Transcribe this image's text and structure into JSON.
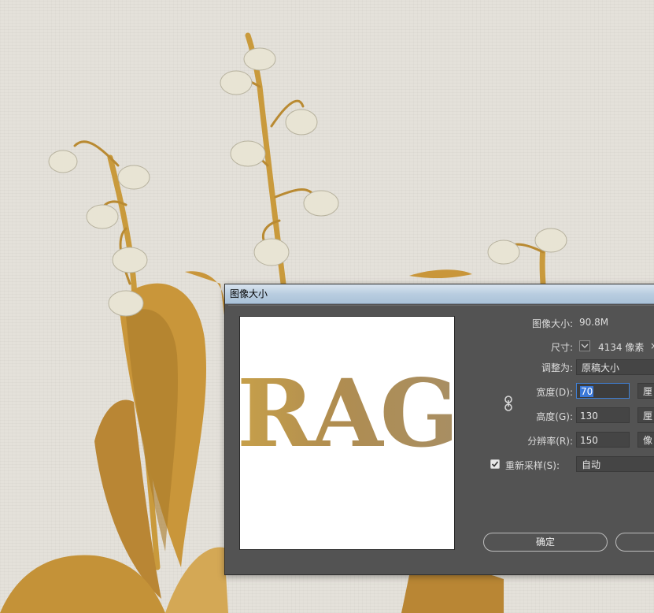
{
  "dialog": {
    "title": "图像大小",
    "preview_text": "RAG",
    "image_size_label": "图像大小:",
    "image_size_value": "90.8M",
    "dimensions_label": "尺寸:",
    "dimensions_value": "4134 像素",
    "dimensions_extra": "×",
    "fit_to_label": "调整为:",
    "fit_to_value": "原稿大小",
    "width_label": "宽度(D):",
    "width_value": "70",
    "width_unit": "厘",
    "height_label": "高度(G):",
    "height_value": "130",
    "height_unit": "厘",
    "resolution_label": "分辨率(R):",
    "resolution_value": "150",
    "resolution_unit": "像",
    "resample_label": "重新采样(S):",
    "resample_checked": true,
    "resample_value": "自动",
    "ok_label": "确定",
    "cancel_label": ""
  },
  "colors": {
    "dialog_bg": "#535353",
    "title_bar": "#b9cde0",
    "field_bg": "#454545",
    "focus": "#3b78d8",
    "text_gold": "#c7a04a"
  },
  "icons": [
    "link-chain-icon",
    "checkmark-icon",
    "chevron-down-icon"
  ]
}
